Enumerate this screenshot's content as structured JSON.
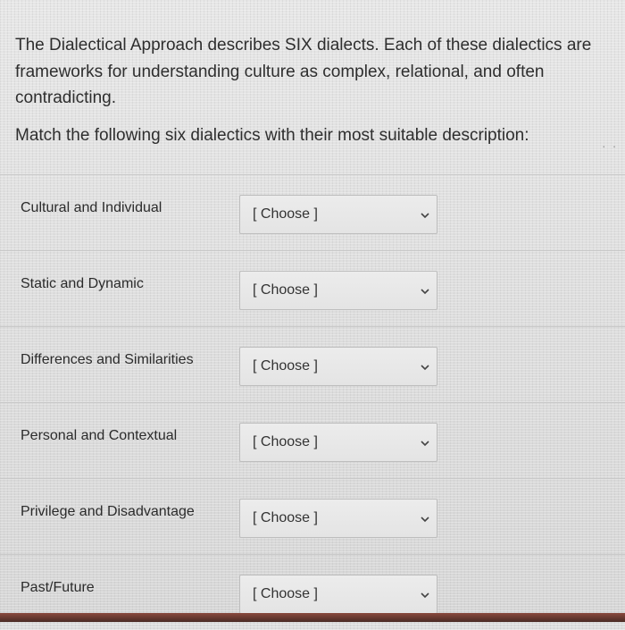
{
  "question": {
    "paragraph1": "The Dialectical Approach describes SIX dialects. Each of these dialectics are frameworks for understanding culture as complex, relational, and often contradicting.",
    "paragraph2": "Match the following six dialectics with their most suitable description:",
    "trailing_dots": ". ."
  },
  "answers": [
    {
      "label": "Cultural and Individual",
      "selected": "[ Choose ]",
      "icon": "chevron-down-icon"
    },
    {
      "label": "Static and Dynamic",
      "selected": "[ Choose ]",
      "icon": "chevron-down-icon"
    },
    {
      "label": "Differences and Similarities",
      "selected": "[ Choose ]",
      "icon": "chevron-down-icon"
    },
    {
      "label": "Personal and Contextual",
      "selected": "[ Choose ]",
      "icon": "chevron-down-icon"
    },
    {
      "label": "Privilege and Disadvantage",
      "selected": "[ Choose ]",
      "icon": "chevron-down-icon"
    },
    {
      "label": "Past/Future",
      "selected": "[ Choose ]",
      "icon": "chevron-down-icon"
    }
  ],
  "colors": {
    "text": "#2e2e2e",
    "select_border": "#bdbdbd",
    "bottom_bar": "#6b3a31"
  }
}
